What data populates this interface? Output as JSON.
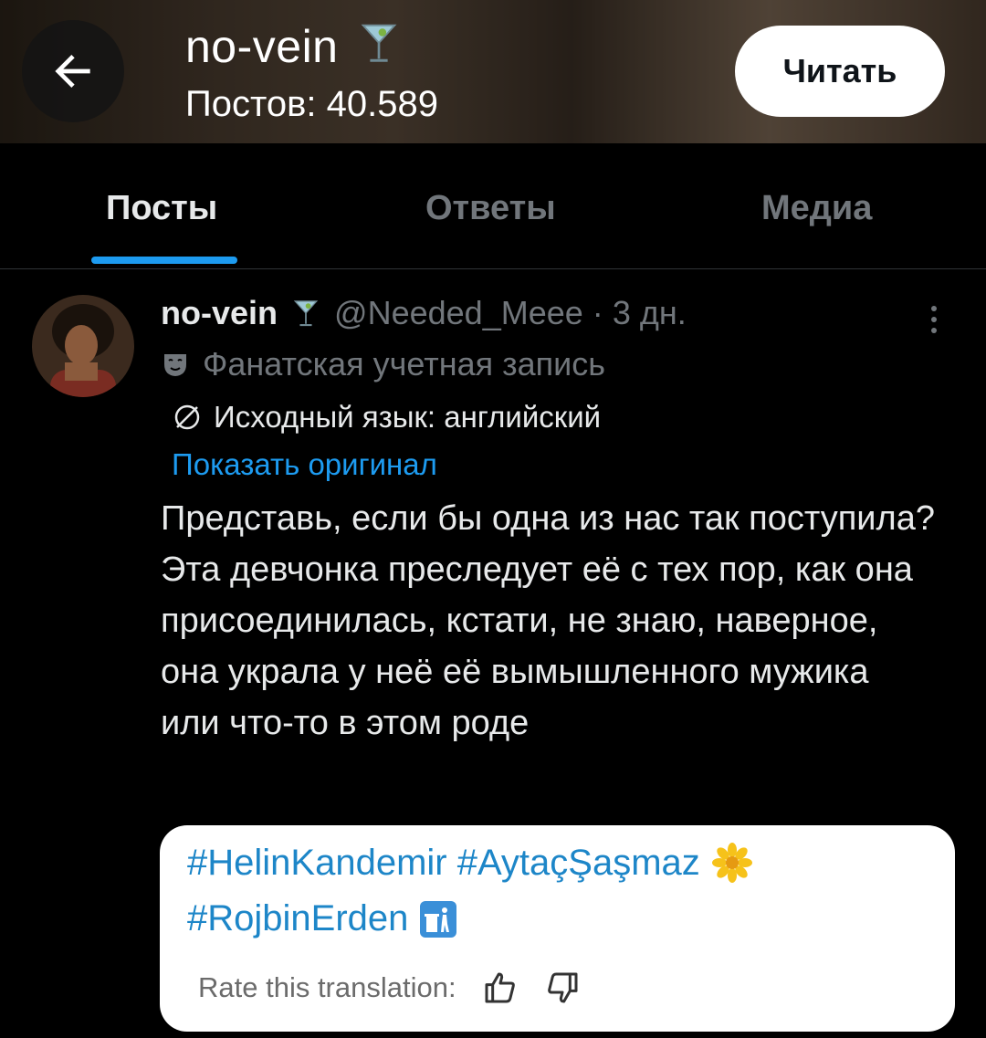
{
  "header": {
    "name": "no-vein",
    "name_emoji": "cocktail-glass",
    "posts_count": "Постов: 40.589",
    "follow_label": "Читать"
  },
  "tabs": [
    {
      "label": "Посты",
      "active": true
    },
    {
      "label": "Ответы",
      "active": false
    },
    {
      "label": "Медиа",
      "active": false
    }
  ],
  "post": {
    "author_name": "no-vein",
    "handle": "@Needed_Meee",
    "separator": "·",
    "time": "3 дн.",
    "account_label": "Фанатская учетная запись",
    "account_icon": "theater-masks-icon",
    "source_language": "Исходный язык: английский",
    "show_original": "Показать оригинал",
    "text": "Представь, если бы одна из нас так поступила? Эта девчонка преследует её с тех пор, как она присоединилась, кстати, не знаю, наверное, она украла у неё её вымышленного мужика или что-то в этом роде"
  },
  "translation_card": {
    "line1": "#HelinKandemir #AytaçŞaşmaz",
    "line1_icon": "blossom-icon",
    "line2": "#RojbinErden",
    "line2_icon": "trash-can-icon",
    "rate_label": "Rate this translation:"
  },
  "colors": {
    "accent": "#1d9bf0",
    "background": "#000000",
    "muted": "#71767b",
    "hashtag": "#1d86c8"
  }
}
